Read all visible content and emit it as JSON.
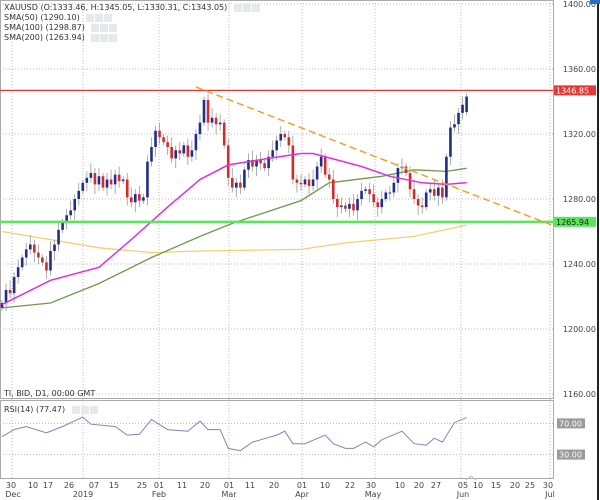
{
  "symbol_info": {
    "ohlc_label": "XAUUSD (O:1333.46, H:1345.05, L:1330.31, C:1343.05)",
    "sma50_label": "SMA(50) (1290.10)",
    "sma100_label": "SMA(100) (1298.87)",
    "sma200_label": "SMA(200) (1263.94)",
    "feed_label": "Tl, BID, D1, 00:00 GMT",
    "rsi_label": "RSI(14) (77.47)"
  },
  "price_axis": {
    "ticks": [
      "1400.00",
      "1360.00",
      "1320.00",
      "1280.00",
      "1240.00",
      "1200.00",
      "1160.00"
    ],
    "tick_values": [
      1400,
      1360,
      1320,
      1280,
      1240,
      1200,
      1160
    ],
    "resistance_label": "1346.85",
    "resistance_value": 1346.85,
    "support_label": "1265.94",
    "support_value": 1265.94
  },
  "rsi_axis": {
    "ticks": [
      "70.00",
      "30.00"
    ],
    "tick_values": [
      70,
      30
    ]
  },
  "date_axis": {
    "day_ticks": [
      "30",
      "10",
      "17",
      "26",
      "07",
      "15",
      "25",
      "01",
      "11",
      "20",
      "01",
      "11",
      "20",
      "01",
      "10",
      "22",
      "30",
      "10",
      "20",
      "27",
      "05",
      "10",
      "15",
      "20",
      "25",
      "30"
    ],
    "month_ticks": [
      "Dec",
      "2019",
      "Feb",
      "Mar",
      "Apr",
      "May",
      "Jun",
      "Jul"
    ]
  },
  "colors": {
    "up": "#1f2d8f",
    "down": "#d42a2a",
    "wick": "#9a9a9a",
    "sma50": "#e02ee0",
    "sma100": "#6f9a4a",
    "sma200": "#f0d070",
    "resistance": "#e53935",
    "support": "#5ee35e",
    "trend": "#f0a030",
    "rsi": "#7b88b8",
    "grid": "#b8b8b8"
  },
  "chart_data": {
    "type": "candlestick",
    "closes": [
      1216,
      1224,
      1222,
      1232,
      1238,
      1244,
      1249,
      1252,
      1247,
      1244,
      1241,
      1236,
      1248,
      1252,
      1261,
      1266,
      1270,
      1273,
      1280,
      1285,
      1290,
      1293,
      1296,
      1289,
      1294,
      1287,
      1292,
      1289,
      1295,
      1291,
      1292,
      1281,
      1278,
      1283,
      1279,
      1281,
      1303,
      1312,
      1322,
      1318,
      1315,
      1312,
      1305,
      1310,
      1308,
      1313,
      1306,
      1310,
      1320,
      1327,
      1341,
      1327,
      1330,
      1326,
      1327,
      1313,
      1293,
      1287,
      1290,
      1287,
      1298,
      1304,
      1300,
      1304,
      1302,
      1299,
      1306,
      1310,
      1316,
      1320,
      1318,
      1313,
      1292,
      1290,
      1289,
      1292,
      1288,
      1292,
      1300,
      1306,
      1295,
      1292,
      1280,
      1275,
      1276,
      1274,
      1277,
      1273,
      1280,
      1285,
      1286,
      1283,
      1278,
      1275,
      1280,
      1284,
      1284,
      1290,
      1299,
      1300,
      1296,
      1286,
      1280,
      1276,
      1275,
      1284,
      1286,
      1282,
      1287,
      1281,
      1306,
      1324,
      1326,
      1333,
      1338,
      1343
    ],
    "last_open": 1333.46,
    "last_high": 1345.05,
    "last_low": 1330.31,
    "last_close": 1343.05,
    "sma50": [
      [
        0,
        1215
      ],
      [
        12,
        1230
      ],
      [
        24,
        1238
      ],
      [
        32,
        1255
      ],
      [
        41,
        1275
      ],
      [
        49,
        1292
      ],
      [
        56,
        1301
      ],
      [
        66,
        1305
      ],
      [
        74,
        1308
      ],
      [
        77,
        1308
      ],
      [
        89,
        1300
      ],
      [
        96,
        1294
      ],
      [
        104,
        1290
      ],
      [
        110,
        1289
      ],
      [
        115,
        1290.1
      ]
    ],
    "sma100": [
      [
        0,
        1213
      ],
      [
        12,
        1216
      ],
      [
        24,
        1228
      ],
      [
        37,
        1244
      ],
      [
        49,
        1257
      ],
      [
        57,
        1265
      ],
      [
        74,
        1279
      ],
      [
        81,
        1290
      ],
      [
        94,
        1294
      ],
      [
        102,
        1298
      ],
      [
        110,
        1297
      ],
      [
        115,
        1298.87
      ]
    ],
    "sma200": [
      [
        0,
        1260
      ],
      [
        12,
        1255
      ],
      [
        24,
        1250
      ],
      [
        37,
        1247
      ],
      [
        49,
        1248
      ],
      [
        74,
        1249
      ],
      [
        85,
        1253
      ],
      [
        102,
        1257
      ],
      [
        115,
        1263.94
      ]
    ],
    "trendline": [
      [
        48,
        1349
      ],
      [
        136,
        1264
      ]
    ],
    "rsi": [
      [
        0,
        53
      ],
      [
        3,
        62
      ],
      [
        6,
        66
      ],
      [
        11,
        58
      ],
      [
        15,
        66
      ],
      [
        20,
        78
      ],
      [
        22,
        69
      ],
      [
        28,
        66
      ],
      [
        31,
        55
      ],
      [
        34,
        56
      ],
      [
        37,
        75
      ],
      [
        41,
        62
      ],
      [
        46,
        60
      ],
      [
        49,
        73
      ],
      [
        51,
        62
      ],
      [
        54,
        62
      ],
      [
        56,
        38
      ],
      [
        59,
        35
      ],
      [
        62,
        46
      ],
      [
        64,
        49
      ],
      [
        68,
        55
      ],
      [
        70,
        60
      ],
      [
        72,
        44
      ],
      [
        75,
        44
      ],
      [
        80,
        55
      ],
      [
        82,
        44
      ],
      [
        85,
        38
      ],
      [
        87,
        38
      ],
      [
        90,
        46
      ],
      [
        92,
        40
      ],
      [
        94,
        49
      ],
      [
        99,
        60
      ],
      [
        102,
        44
      ],
      [
        105,
        42
      ],
      [
        107,
        51
      ],
      [
        109,
        46
      ],
      [
        112,
        71
      ],
      [
        115,
        77.47
      ]
    ],
    "price_range": [
      1160,
      1400
    ],
    "rsi_range": [
      0,
      100
    ]
  }
}
